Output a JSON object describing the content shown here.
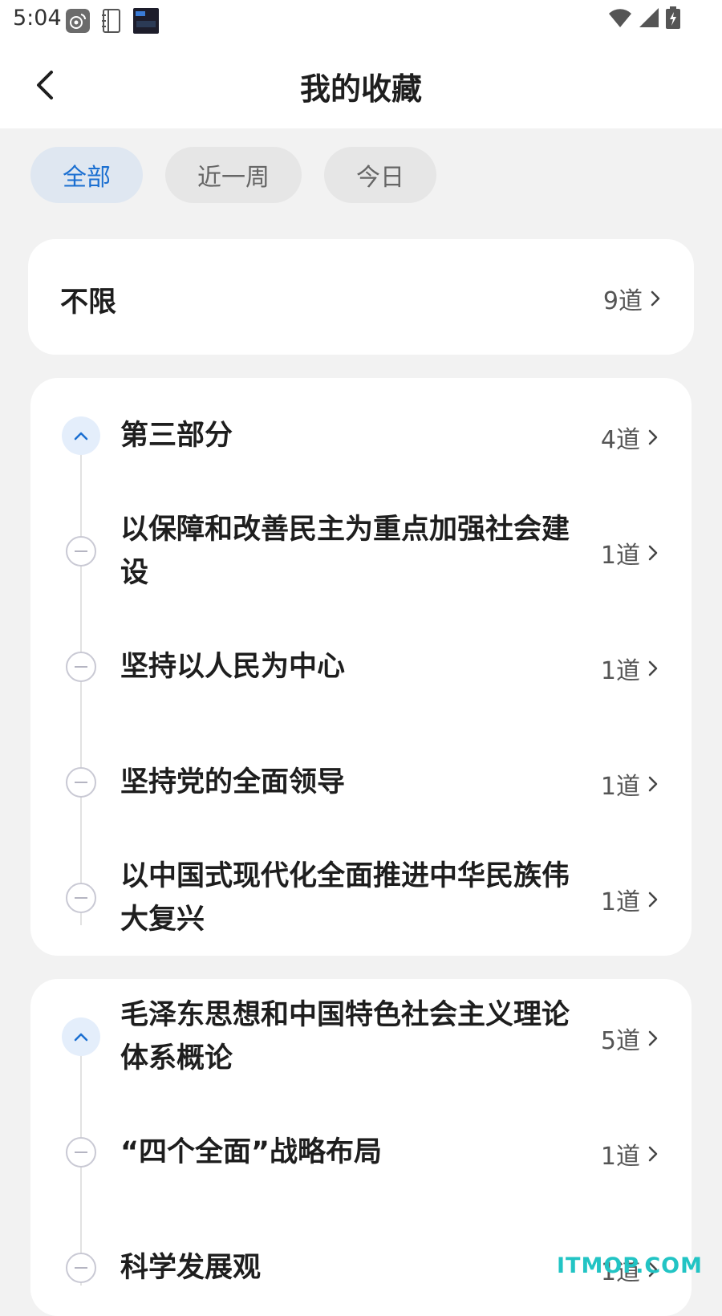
{
  "status": {
    "time": "5:04"
  },
  "header": {
    "title": "我的收藏"
  },
  "filters": [
    {
      "label": "全部",
      "active": true
    },
    {
      "label": "近一周",
      "active": false
    },
    {
      "label": "今日",
      "active": false
    }
  ],
  "unlimited": {
    "label": "不限",
    "count": "9道"
  },
  "group1": {
    "title": "第三部分",
    "count": "4道",
    "items": [
      {
        "label": "以保障和改善民主为重点加强社会建设",
        "count": "1道"
      },
      {
        "label": "坚持以人民为中心",
        "count": "1道"
      },
      {
        "label": "坚持党的全面领导",
        "count": "1道"
      },
      {
        "label": "以中国式现代化全面推进中华民族伟大复兴",
        "count": "1道"
      }
    ]
  },
  "group2": {
    "title": "毛泽东思想和中国特色社会主义理论体系概论",
    "count": "5道",
    "items": [
      {
        "label": "“四个全面”战略布局",
        "count": "1道"
      },
      {
        "label": "科学发展观",
        "count": "1道"
      }
    ]
  },
  "watermark": "ITMOP.COM",
  "colors": {
    "accent": "#1b6fd1",
    "accent_bg": "#dfe7f1",
    "background": "#f2f2f2",
    "card": "#ffffff",
    "watermark": "#22c4c4"
  }
}
